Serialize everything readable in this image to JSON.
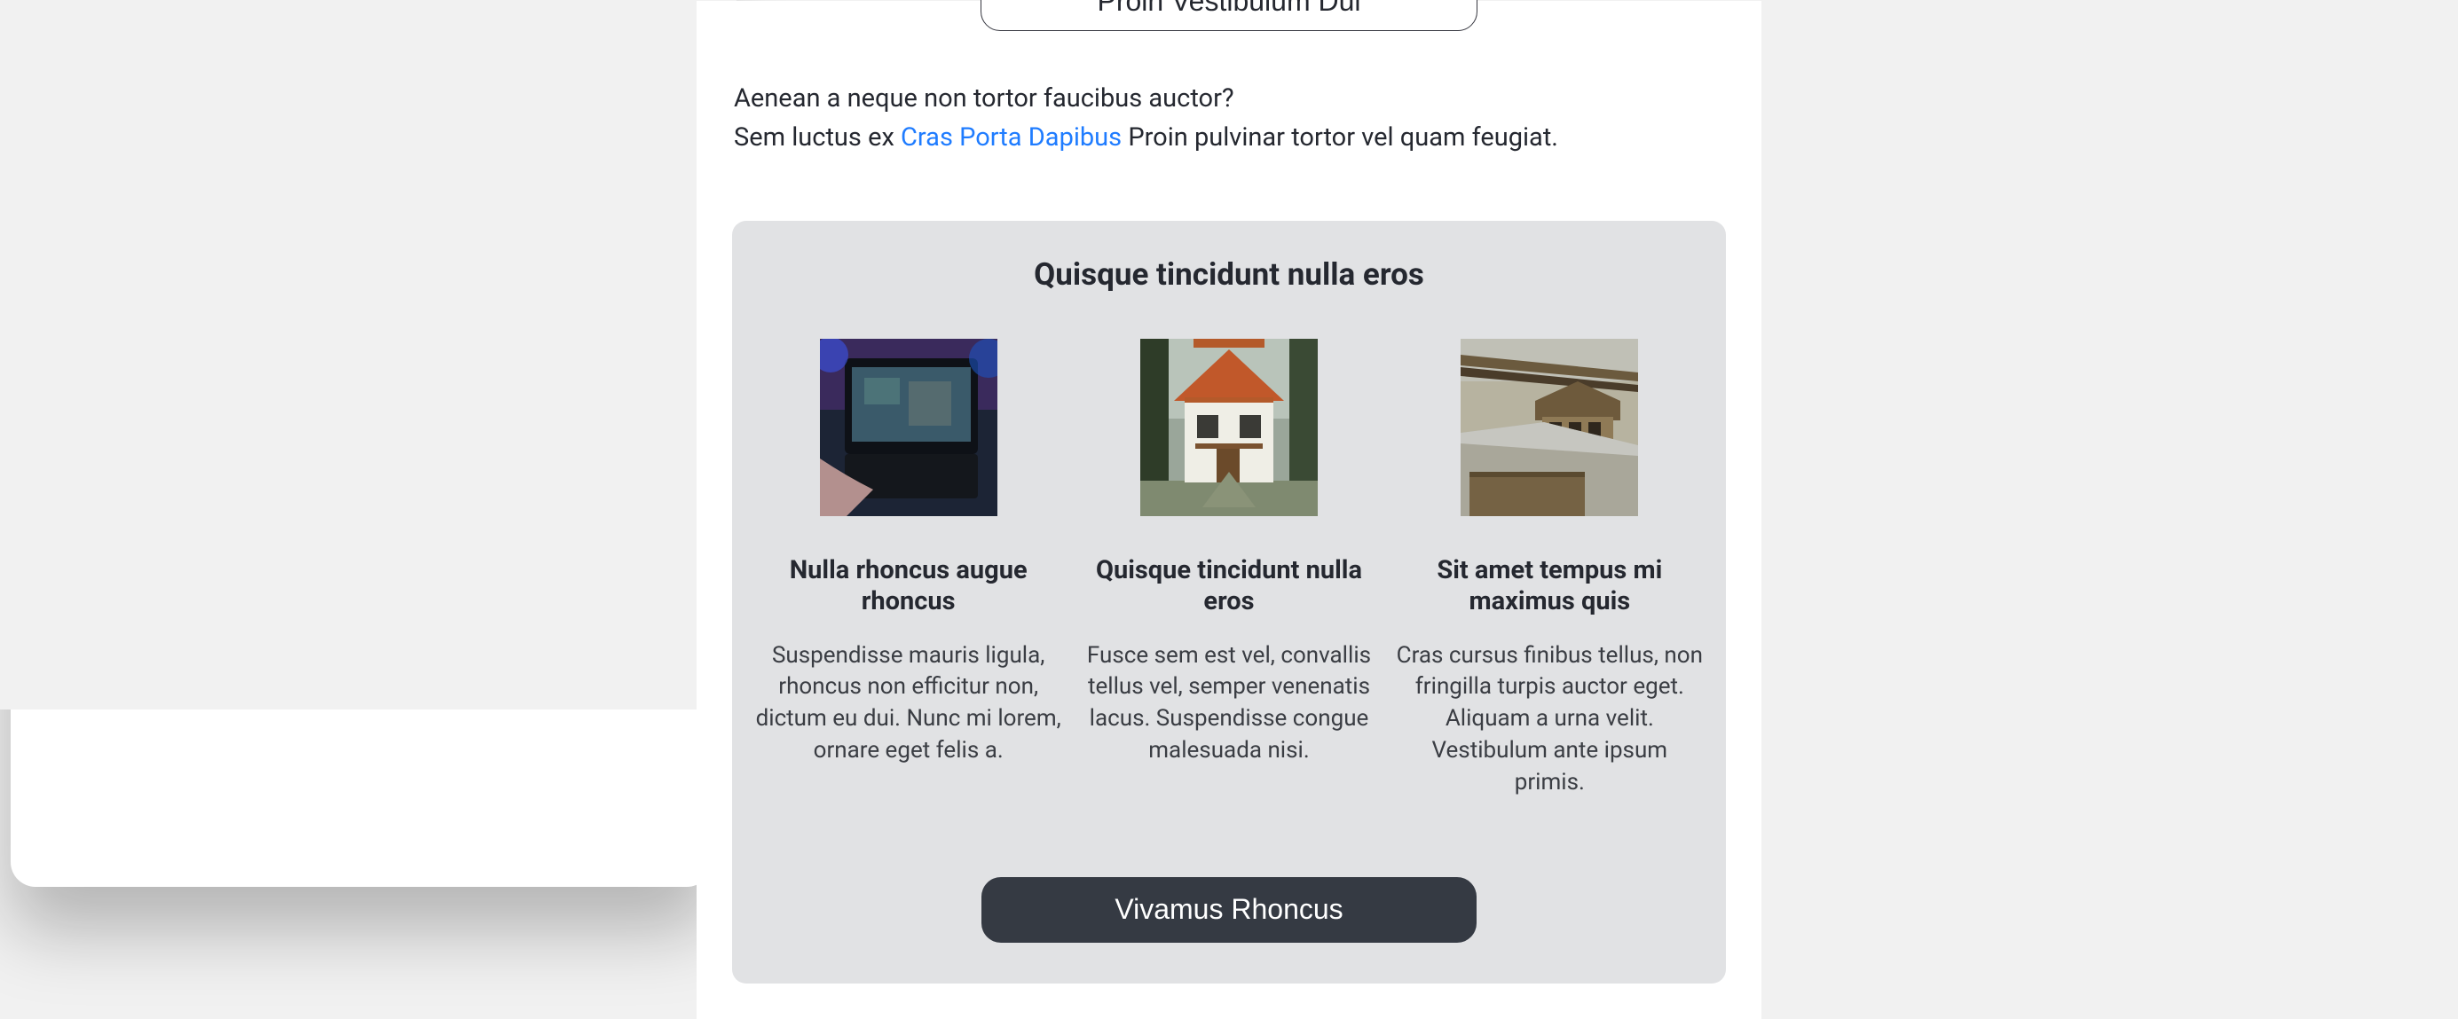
{
  "topButton": {
    "label": "Proin Vestibulum Dui"
  },
  "intro": {
    "line1": "Aenean a neque non tortor faucibus auctor?",
    "line2_before": "Sem luctus ex ",
    "line2_link": "Cras Porta Dapibus",
    "line2_after": " Proin pulvinar tortor vel quam feugiat."
  },
  "panel": {
    "heading": "Quisque tincidunt nulla eros",
    "cards": [
      {
        "title": "Nulla rhoncus augue rhoncus",
        "body": "Suspendisse mauris ligula, rhoncus non efficitur non, dictum eu dui. Nunc mi lorem, ornare eget felis a.",
        "img_alt": "tablet-gaming-thumbnail"
      },
      {
        "title": "Quisque tincidunt nulla eros",
        "body": "Fusce sem est vel, convallis tellus vel, semper venenatis lacus. Suspendisse congue malesuada nisi.",
        "img_alt": "house-thumbnail"
      },
      {
        "title": "Sit amet tempus mi maximus quis",
        "body": "Cras cursus finibus tellus, non fringilla turpis auctor eget. Aliquam a urna velit. Vestibulum ante ipsum primis.",
        "img_alt": "birdhouse-thumbnail"
      }
    ],
    "cta": {
      "label": "Vivamus Rhoncus"
    }
  }
}
